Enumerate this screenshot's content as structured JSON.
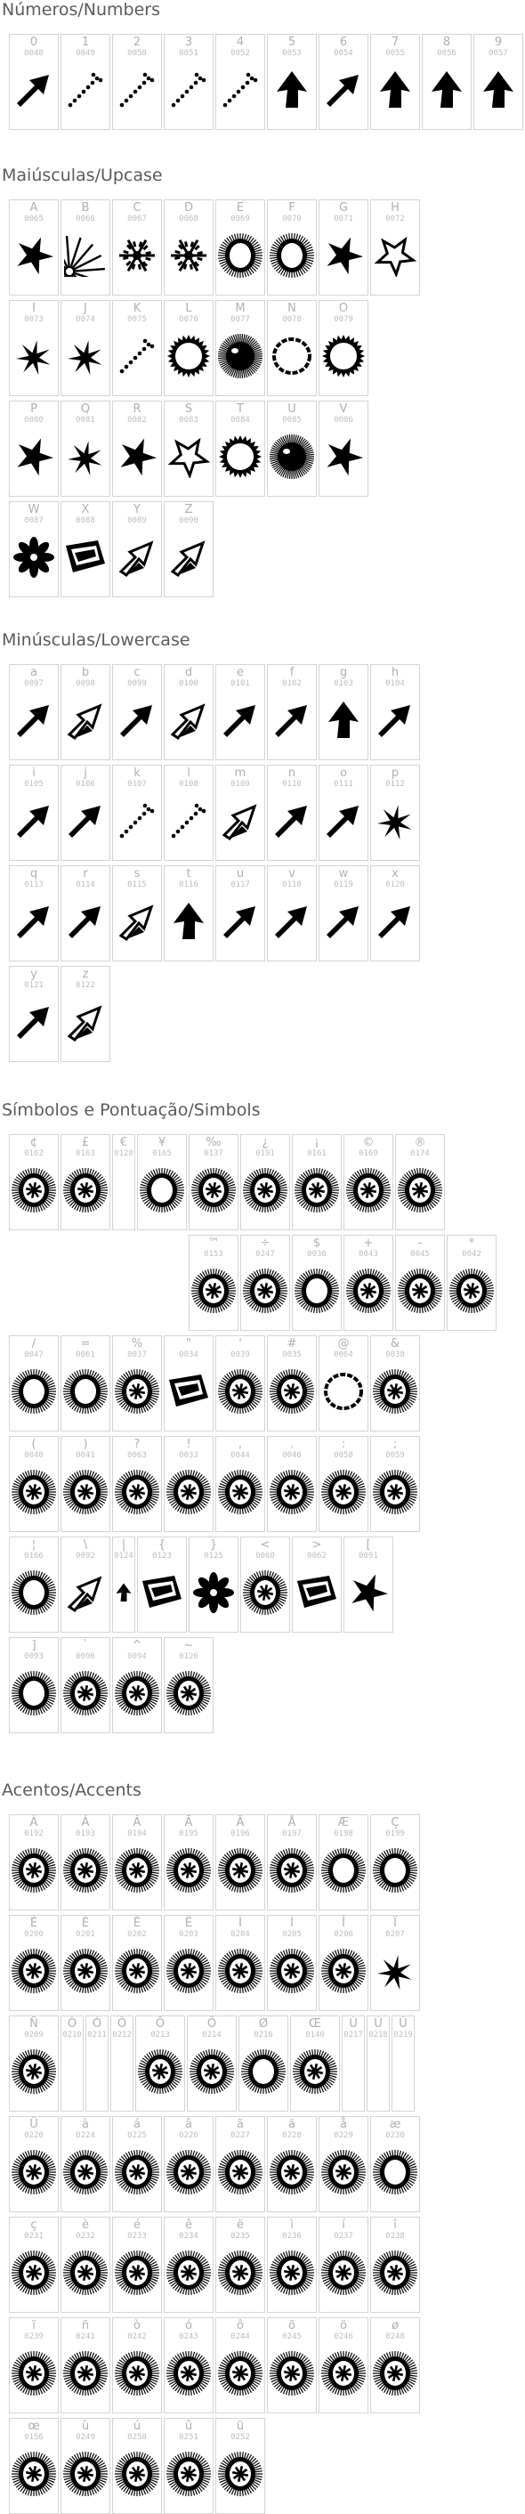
{
  "sections": [
    {
      "title": "Números/Numbers",
      "rows": [
        [
          {
            "ch": "0",
            "code": "0048",
            "glyph": "arrow-ne-icon"
          },
          {
            "ch": "1",
            "code": "0049",
            "glyph": "dotted-arrow-icon"
          },
          {
            "ch": "2",
            "code": "0050",
            "glyph": "dotted-arrow-icon"
          },
          {
            "ch": "3",
            "code": "0051",
            "glyph": "dotted-arrow-icon"
          },
          {
            "ch": "4",
            "code": "0052",
            "glyph": "dotted-arrow-icon"
          },
          {
            "ch": "5",
            "code": "0053",
            "glyph": "arrow-up-icon"
          },
          {
            "ch": "6",
            "code": "0054",
            "glyph": "arrow-ne-icon"
          },
          {
            "ch": "7",
            "code": "0055",
            "glyph": "arrow-up-icon"
          },
          {
            "ch": "8",
            "code": "0056",
            "glyph": "arrow-up-icon"
          },
          {
            "ch": "9",
            "code": "0057",
            "glyph": "arrow-up-icon"
          }
        ]
      ]
    },
    {
      "title": "Maiúsculas/Upcase",
      "rows": [
        [
          {
            "ch": "A",
            "code": "0065",
            "glyph": "star-burst-icon"
          },
          {
            "ch": "B",
            "code": "0066",
            "glyph": "fan-rays-icon"
          },
          {
            "ch": "C",
            "code": "0067",
            "glyph": "snowflake-icon"
          },
          {
            "ch": "D",
            "code": "0068",
            "glyph": "snowflake-icon"
          },
          {
            "ch": "E",
            "code": "0069",
            "glyph": "hairy-ring-icon"
          },
          {
            "ch": "F",
            "code": "0070",
            "glyph": "hairy-ring-icon"
          },
          {
            "ch": "G",
            "code": "0071",
            "glyph": "star-burst-icon"
          },
          {
            "ch": "H",
            "code": "0072",
            "glyph": "star-outline-icon"
          }
        ],
        [
          {
            "ch": "I",
            "code": "0073",
            "glyph": "splash-icon"
          },
          {
            "ch": "J",
            "code": "0074",
            "glyph": "splash-icon"
          },
          {
            "ch": "K",
            "code": "0075",
            "glyph": "dotted-arrow-icon"
          },
          {
            "ch": "L",
            "code": "0076",
            "glyph": "sun-ring-icon"
          },
          {
            "ch": "M",
            "code": "0077",
            "glyph": "fuzzy-ball-icon"
          },
          {
            "ch": "N",
            "code": "0078",
            "glyph": "sketch-ring-icon"
          },
          {
            "ch": "O",
            "code": "0079",
            "glyph": "sun-ring-icon"
          }
        ],
        [
          {
            "ch": "P",
            "code": "0080",
            "glyph": "star-burst-icon"
          },
          {
            "ch": "Q",
            "code": "0081",
            "glyph": "splash-icon"
          },
          {
            "ch": "R",
            "code": "0082",
            "glyph": "star-burst-icon"
          },
          {
            "ch": "S",
            "code": "0083",
            "glyph": "star-outline-icon"
          },
          {
            "ch": "T",
            "code": "0084",
            "glyph": "sun-ring-icon"
          },
          {
            "ch": "U",
            "code": "0085",
            "glyph": "fuzzy-ball-icon"
          },
          {
            "ch": "V",
            "code": "0086",
            "glyph": "star-burst-icon"
          }
        ],
        [
          {
            "ch": "W",
            "code": "0087",
            "glyph": "flower-icon"
          },
          {
            "ch": "X",
            "code": "0088",
            "glyph": "ribbon-icon"
          },
          {
            "ch": "Y",
            "code": "0089",
            "glyph": "arrow-3d-icon"
          },
          {
            "ch": "Z",
            "code": "0090",
            "glyph": "arrow-3d-icon"
          }
        ]
      ]
    },
    {
      "title": "Minúsculas/Lowercase",
      "rows": [
        [
          {
            "ch": "a",
            "code": "0097",
            "glyph": "arrow-ne-icon"
          },
          {
            "ch": "b",
            "code": "0098",
            "glyph": "arrow-3d-icon"
          },
          {
            "ch": "c",
            "code": "0099",
            "glyph": "arrow-ne-icon"
          },
          {
            "ch": "d",
            "code": "0100",
            "glyph": "arrow-3d-icon"
          },
          {
            "ch": "e",
            "code": "0101",
            "glyph": "arrow-ne-icon"
          },
          {
            "ch": "f",
            "code": "0102",
            "glyph": "arrow-ne-icon"
          },
          {
            "ch": "g",
            "code": "0103",
            "glyph": "arrow-up-icon"
          },
          {
            "ch": "h",
            "code": "0104",
            "glyph": "arrow-ne-icon"
          }
        ],
        [
          {
            "ch": "i",
            "code": "0105",
            "glyph": "arrow-ne-icon"
          },
          {
            "ch": "j",
            "code": "0106",
            "glyph": "arrow-ne-icon"
          },
          {
            "ch": "k",
            "code": "0107",
            "glyph": "dotted-arrow-icon"
          },
          {
            "ch": "l",
            "code": "0108",
            "glyph": "dotted-arrow-icon"
          },
          {
            "ch": "m",
            "code": "0109",
            "glyph": "arrow-3d-icon"
          },
          {
            "ch": "n",
            "code": "0110",
            "glyph": "arrow-ne-icon"
          },
          {
            "ch": "o",
            "code": "0111",
            "glyph": "arrow-ne-icon"
          },
          {
            "ch": "p",
            "code": "0112",
            "glyph": "splash-icon"
          }
        ],
        [
          {
            "ch": "q",
            "code": "0113",
            "glyph": "arrow-ne-icon"
          },
          {
            "ch": "r",
            "code": "0114",
            "glyph": "arrow-ne-icon"
          },
          {
            "ch": "s",
            "code": "0115",
            "glyph": "arrow-3d-icon"
          },
          {
            "ch": "t",
            "code": "0116",
            "glyph": "arrow-up-icon"
          },
          {
            "ch": "u",
            "code": "0117",
            "glyph": "arrow-ne-icon"
          },
          {
            "ch": "v",
            "code": "0118",
            "glyph": "arrow-ne-icon"
          },
          {
            "ch": "w",
            "code": "0119",
            "glyph": "arrow-ne-icon"
          },
          {
            "ch": "x",
            "code": "0120",
            "glyph": "arrow-ne-icon"
          }
        ],
        [
          {
            "ch": "y",
            "code": "0121",
            "glyph": "arrow-ne-icon"
          },
          {
            "ch": "z",
            "code": "0122",
            "glyph": "arrow-3d-icon"
          }
        ]
      ]
    },
    {
      "title": "Símbolos e Pontuação/Simbols",
      "rows": [
        [
          {
            "ch": "¢",
            "code": "0162",
            "glyph": "badge-icon"
          },
          {
            "ch": "£",
            "code": "0163",
            "glyph": "badge-icon"
          },
          {
            "ch": "€",
            "code": "0128",
            "glyph": "",
            "narrow": true
          },
          {
            "ch": "¥",
            "code": "0165",
            "glyph": "hairy-ring-icon"
          },
          {
            "ch": "‰",
            "code": "0137",
            "glyph": "badge-icon"
          },
          {
            "ch": "¿",
            "code": "0191",
            "glyph": "badge-icon"
          },
          {
            "ch": "¡",
            "code": "0161",
            "glyph": "badge-icon"
          },
          {
            "ch": "©",
            "code": "0169",
            "glyph": "badge-icon"
          },
          {
            "ch": "®",
            "code": "0174",
            "glyph": "badge-icon"
          }
        ],
        [
          {
            "ch": "™",
            "code": "0153",
            "glyph": "badge-icon"
          },
          {
            "ch": "÷",
            "code": "0247",
            "glyph": "badge-icon"
          },
          {
            "ch": "$",
            "code": "0036",
            "glyph": "hairy-ring-icon"
          },
          {
            "ch": "+",
            "code": "0043",
            "glyph": "badge-icon"
          },
          {
            "ch": "-",
            "code": "0045",
            "glyph": "badge-icon"
          },
          {
            "ch": "*",
            "code": "0042",
            "glyph": "badge-icon"
          }
        ],
        [
          {
            "ch": "/",
            "code": "0047",
            "glyph": "hairy-ring-icon"
          },
          {
            "ch": "=",
            "code": "0061",
            "glyph": "hairy-ring-icon"
          },
          {
            "ch": "%",
            "code": "0037",
            "glyph": "badge-icon"
          },
          {
            "ch": "\"",
            "code": "0034",
            "glyph": "ribbon-icon"
          },
          {
            "ch": "'",
            "code": "0039",
            "glyph": "badge-icon"
          },
          {
            "ch": "#",
            "code": "0035",
            "glyph": "badge-icon"
          },
          {
            "ch": "@",
            "code": "0064",
            "glyph": "sketch-ring-icon"
          },
          {
            "ch": "&",
            "code": "0038",
            "glyph": "badge-icon"
          }
        ],
        [
          {
            "ch": "(",
            "code": "0040",
            "glyph": "badge-icon"
          },
          {
            "ch": ")",
            "code": "0041",
            "glyph": "badge-icon"
          },
          {
            "ch": "?",
            "code": "0063",
            "glyph": "badge-icon"
          },
          {
            "ch": "!",
            "code": "0033",
            "glyph": "badge-icon"
          },
          {
            "ch": ",",
            "code": "0044",
            "glyph": "badge-icon"
          },
          {
            "ch": ".",
            "code": "0046",
            "glyph": "badge-icon"
          },
          {
            "ch": ":",
            "code": "0058",
            "glyph": "badge-icon"
          },
          {
            "ch": ";",
            "code": "0059",
            "glyph": "badge-icon"
          }
        ],
        [
          {
            "ch": "¦",
            "code": "0166",
            "glyph": "hairy-ring-icon"
          },
          {
            "ch": "\\",
            "code": "0092",
            "glyph": "arrow-3d-icon"
          },
          {
            "ch": "|",
            "code": "0124",
            "glyph": "arrow-up-icon",
            "narrow": true
          },
          {
            "ch": "{",
            "code": "0123",
            "glyph": "ribbon-icon"
          },
          {
            "ch": "}",
            "code": "0125",
            "glyph": "flower-icon"
          },
          {
            "ch": "<",
            "code": "0060",
            "glyph": "badge-icon"
          },
          {
            "ch": ">",
            "code": "0062",
            "glyph": "ribbon-icon"
          },
          {
            "ch": "[",
            "code": "0091",
            "glyph": "star-burst-icon"
          }
        ],
        [
          {
            "ch": "]",
            "code": "0093",
            "glyph": "hairy-ring-icon"
          },
          {
            "ch": "`",
            "code": "0096",
            "glyph": "badge-icon"
          },
          {
            "ch": "^",
            "code": "0094",
            "glyph": "badge-icon"
          },
          {
            "ch": "~",
            "code": "0126",
            "glyph": "badge-icon"
          }
        ]
      ]
    },
    {
      "title": "Acentos/Accents",
      "rows": [
        [
          {
            "ch": "À",
            "code": "0192",
            "glyph": "badge-icon"
          },
          {
            "ch": "Á",
            "code": "0193",
            "glyph": "badge-icon"
          },
          {
            "ch": "Â",
            "code": "0194",
            "glyph": "badge-icon"
          },
          {
            "ch": "Ã",
            "code": "0195",
            "glyph": "badge-icon"
          },
          {
            "ch": "Ä",
            "code": "0196",
            "glyph": "badge-icon"
          },
          {
            "ch": "Å",
            "code": "0197",
            "glyph": "badge-icon"
          },
          {
            "ch": "Æ",
            "code": "0198",
            "glyph": "hairy-ring-icon"
          },
          {
            "ch": "Ç",
            "code": "0199",
            "glyph": "hairy-ring-icon"
          }
        ],
        [
          {
            "ch": "È",
            "code": "0200",
            "glyph": "badge-icon"
          },
          {
            "ch": "É",
            "code": "0201",
            "glyph": "badge-icon"
          },
          {
            "ch": "Ê",
            "code": "0202",
            "glyph": "badge-icon"
          },
          {
            "ch": "Ë",
            "code": "0203",
            "glyph": "badge-icon"
          },
          {
            "ch": "Ì",
            "code": "0204",
            "glyph": "badge-icon"
          },
          {
            "ch": "Í",
            "code": "0205",
            "glyph": "badge-icon"
          },
          {
            "ch": "Î",
            "code": "0206",
            "glyph": "badge-icon"
          },
          {
            "ch": "Ï",
            "code": "0207",
            "glyph": "splash-icon"
          }
        ],
        [
          {
            "ch": "Ñ",
            "code": "0209",
            "glyph": "badge-icon"
          },
          {
            "ch": "Ò",
            "code": "0210",
            "glyph": "",
            "narrow": true
          },
          {
            "ch": "Ó",
            "code": "0211",
            "glyph": "",
            "narrow": true
          },
          {
            "ch": "Ô",
            "code": "0212",
            "glyph": "",
            "narrow": true
          },
          {
            "ch": "Õ",
            "code": "0213",
            "glyph": "badge-icon"
          },
          {
            "ch": "Ö",
            "code": "0214",
            "glyph": "badge-icon"
          },
          {
            "ch": "Ø",
            "code": "0216",
            "glyph": "hairy-ring-icon"
          },
          {
            "ch": "Œ",
            "code": "0140",
            "glyph": "badge-icon"
          },
          {
            "ch": "Ù",
            "code": "0217",
            "glyph": "",
            "narrow": true
          },
          {
            "ch": "Ú",
            "code": "0218",
            "glyph": "",
            "narrow": true
          },
          {
            "ch": "Û",
            "code": "0219",
            "glyph": "",
            "narrow": true
          }
        ],
        [
          {
            "ch": "Ü",
            "code": "0220",
            "glyph": "badge-icon"
          },
          {
            "ch": "à",
            "code": "0224",
            "glyph": "badge-icon"
          },
          {
            "ch": "á",
            "code": "0225",
            "glyph": "badge-icon"
          },
          {
            "ch": "â",
            "code": "0226",
            "glyph": "badge-icon"
          },
          {
            "ch": "ã",
            "code": "0227",
            "glyph": "badge-icon"
          },
          {
            "ch": "ä",
            "code": "0228",
            "glyph": "badge-icon"
          },
          {
            "ch": "å",
            "code": "0229",
            "glyph": "badge-icon"
          },
          {
            "ch": "æ",
            "code": "0230",
            "glyph": "hairy-ring-icon"
          }
        ],
        [
          {
            "ch": "ç",
            "code": "0231",
            "glyph": "badge-icon"
          },
          {
            "ch": "è",
            "code": "0232",
            "glyph": "badge-icon"
          },
          {
            "ch": "é",
            "code": "0233",
            "glyph": "badge-icon"
          },
          {
            "ch": "ê",
            "code": "0234",
            "glyph": "badge-icon"
          },
          {
            "ch": "ë",
            "code": "0235",
            "glyph": "badge-icon"
          },
          {
            "ch": "ì",
            "code": "0236",
            "glyph": "badge-icon"
          },
          {
            "ch": "í",
            "code": "0237",
            "glyph": "badge-icon"
          },
          {
            "ch": "î",
            "code": "0238",
            "glyph": "badge-icon"
          }
        ],
        [
          {
            "ch": "ï",
            "code": "0239",
            "glyph": "badge-icon"
          },
          {
            "ch": "ñ",
            "code": "0241",
            "glyph": "badge-icon"
          },
          {
            "ch": "ò",
            "code": "0242",
            "glyph": "badge-icon"
          },
          {
            "ch": "ó",
            "code": "0243",
            "glyph": "badge-icon"
          },
          {
            "ch": "ô",
            "code": "0244",
            "glyph": "badge-icon"
          },
          {
            "ch": "õ",
            "code": "0245",
            "glyph": "badge-icon"
          },
          {
            "ch": "ö",
            "code": "0246",
            "glyph": "badge-icon"
          },
          {
            "ch": "ø",
            "code": "0248",
            "glyph": "badge-icon"
          }
        ],
        [
          {
            "ch": "œ",
            "code": "0156",
            "glyph": "badge-icon"
          },
          {
            "ch": "ù",
            "code": "0249",
            "glyph": "badge-icon"
          },
          {
            "ch": "ú",
            "code": "0250",
            "glyph": "badge-icon"
          },
          {
            "ch": "û",
            "code": "0251",
            "glyph": "badge-icon"
          },
          {
            "ch": "ü",
            "code": "0252",
            "glyph": "badge-icon"
          }
        ]
      ]
    }
  ]
}
